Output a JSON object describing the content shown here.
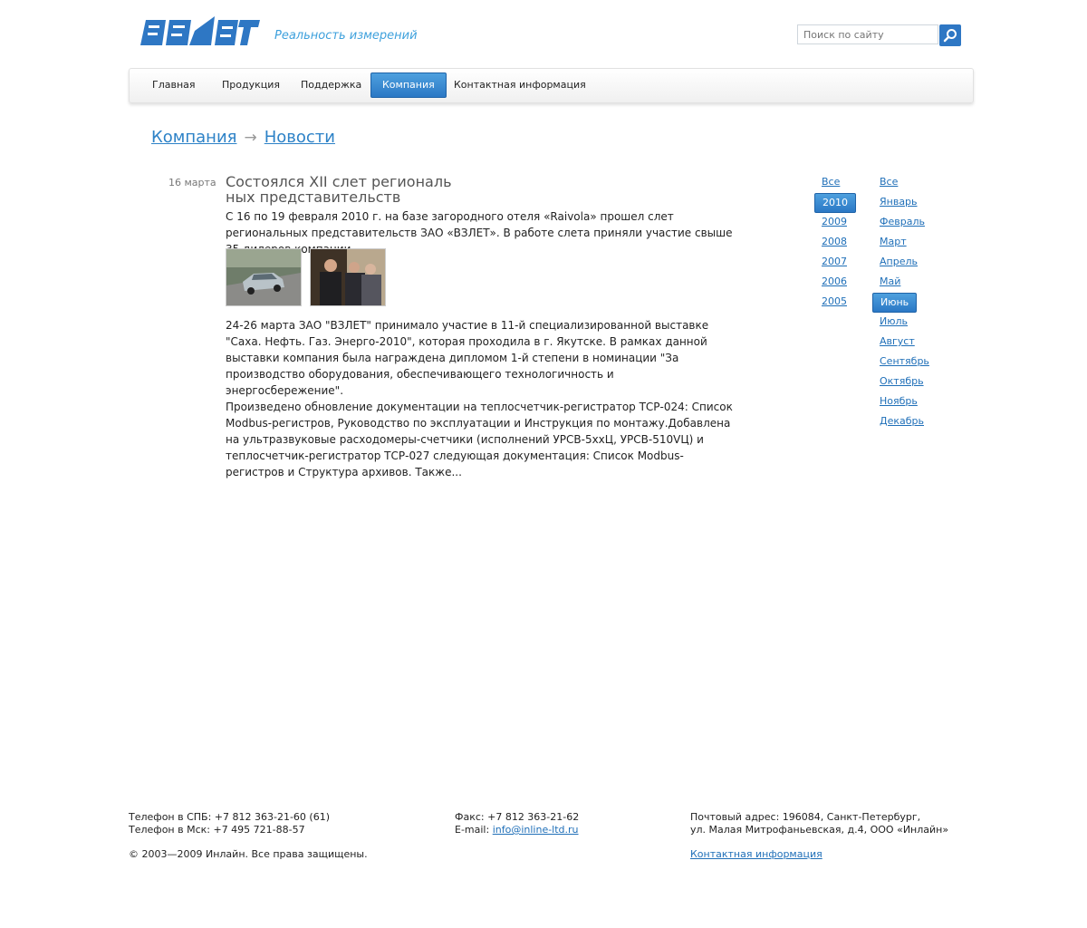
{
  "header": {
    "logo_text": "ВЗЛЕТ",
    "slogan": "Реальность измерений",
    "search_placeholder": "Поиск по сайту",
    "brand_color": "#2e77c4"
  },
  "nav": {
    "items": [
      "Главная",
      "Продукция",
      "Поддержка",
      "Компания",
      "Контактная информация"
    ],
    "active": "Компания"
  },
  "breadcrumbs": [
    "Компания",
    "Новости"
  ],
  "news": {
    "date": "16 марта",
    "title_line1": "Состоялся XII слет региональ",
    "title_line2": "ных представительств",
    "paragraph1": "С 16 по 19 февраля 2010 г. на базе загородного отеля «Raivola» прошел слет региональных представительств ЗАО «ВЗЛЕТ». В работе слета приняли участие свыше 35 дилеров компании.",
    "paragraph2": "24-26 марта ЗАО \"ВЗЛЕТ\" принимало участие в 11-й специализированной выставке \"Саха. Нефть. Газ. Энерго-2010\", которая проходила в г. Якутске. В рамках данной выставки компания была награждена дипломом 1-й степени в номинации \"За производство оборудования, обеспечивающего технологичность и энергосбережение\".",
    "paragraph3": "Произведено обновление документации на теплосчетчик-регистратор ТСР-024: Список Modbus-регистров, Руководство по эксплуатации и Инструкция по монтажу.Добавлена на ультразвуковые расходомеры-счетчики (исполнений УРСВ-5ххЦ, УРСВ-510VЦ) и теплосчетчик-регистратор ТСР-027 следующая документация: Список Modbus-регистров и Структура архивов. Также..."
  },
  "archive": {
    "years": [
      "Все",
      "2010",
      "2009",
      "2008",
      "2007",
      "2006",
      "2005"
    ],
    "selected_year": "2010",
    "months": [
      "Все",
      "Январь",
      "Февраль",
      "Март",
      "Апрель",
      "Май",
      "Июнь",
      "Июль",
      "Август",
      "Сентябрь",
      "Октябрь",
      "Ноябрь",
      "Декабрь"
    ],
    "selected_month": "Июнь"
  },
  "footer": {
    "phone_spb": "Телефон в СПБ: +7 812 363-21-60 (61)",
    "phone_msk": "Телефон в Мск: +7 495 721-88-57",
    "copyright": "© 2003—2009 Инлайн. Все права защищены.",
    "fax": "Факс: +7 812 363-21-62",
    "email_label": "E-mail:",
    "email": "info@inline-ltd.ru",
    "address_line1": "Почтовый адрес: 196084, Санкт-Петербург,",
    "address_line2": "ул. Малая Митрофаньевская, д.4, ООО «Инлайн»",
    "contacts_link": "Контактная информация"
  }
}
